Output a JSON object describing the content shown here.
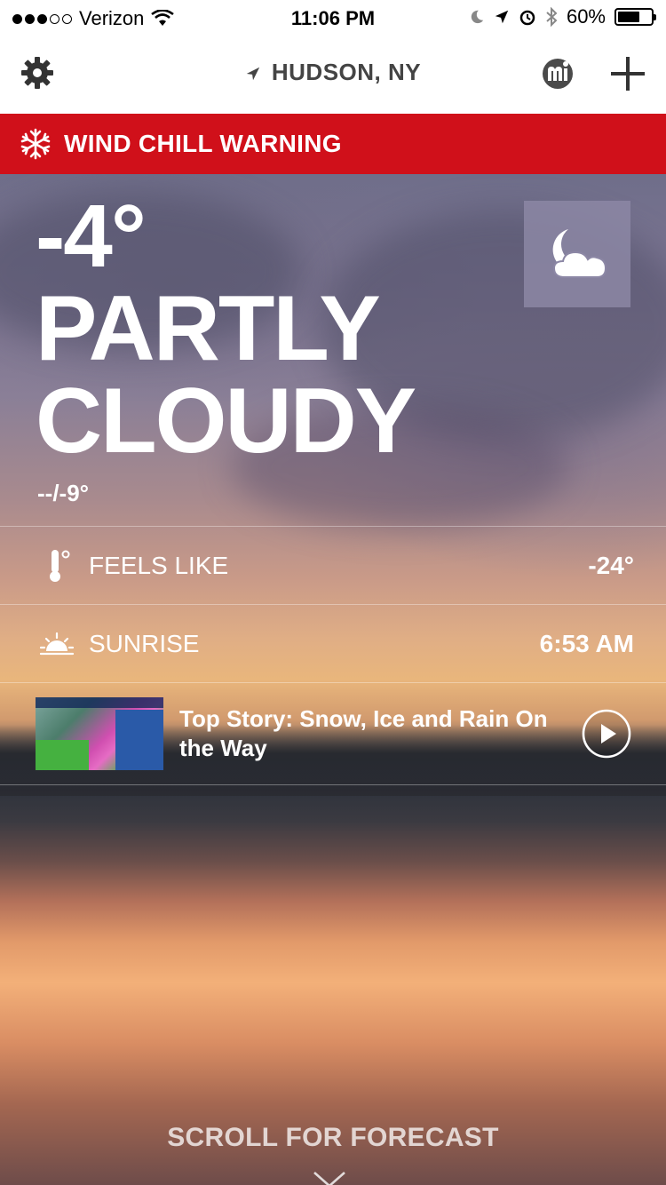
{
  "status_bar": {
    "carrier": "Verizon",
    "time": "11:06 PM",
    "battery": "60%",
    "signal_bars": 3,
    "signal_total": 5
  },
  "nav": {
    "location": "HUDSON, NY",
    "icons": [
      "gear-icon",
      "location-arrow-icon",
      "mi-logo-icon",
      "plus-icon"
    ]
  },
  "alert": {
    "text": "WIND CHILL WARNING",
    "color": "#d0101a"
  },
  "current": {
    "temperature": "-4°",
    "condition_line1": "PARTLY",
    "condition_line2": "CLOUDY",
    "hi_lo": "--/-9°",
    "condition_icon": "moon-cloud-icon"
  },
  "details": [
    {
      "label": "FEELS LIKE",
      "value": "-24°",
      "icon": "thermometer-icon"
    },
    {
      "label": "SUNRISE",
      "value": "6:53 AM",
      "icon": "sunrise-icon"
    }
  ],
  "top_story": {
    "title": "Top Story: Snow, Ice and Rain On the Way"
  },
  "footer": {
    "scroll_label": "SCROLL FOR FORECAST"
  }
}
